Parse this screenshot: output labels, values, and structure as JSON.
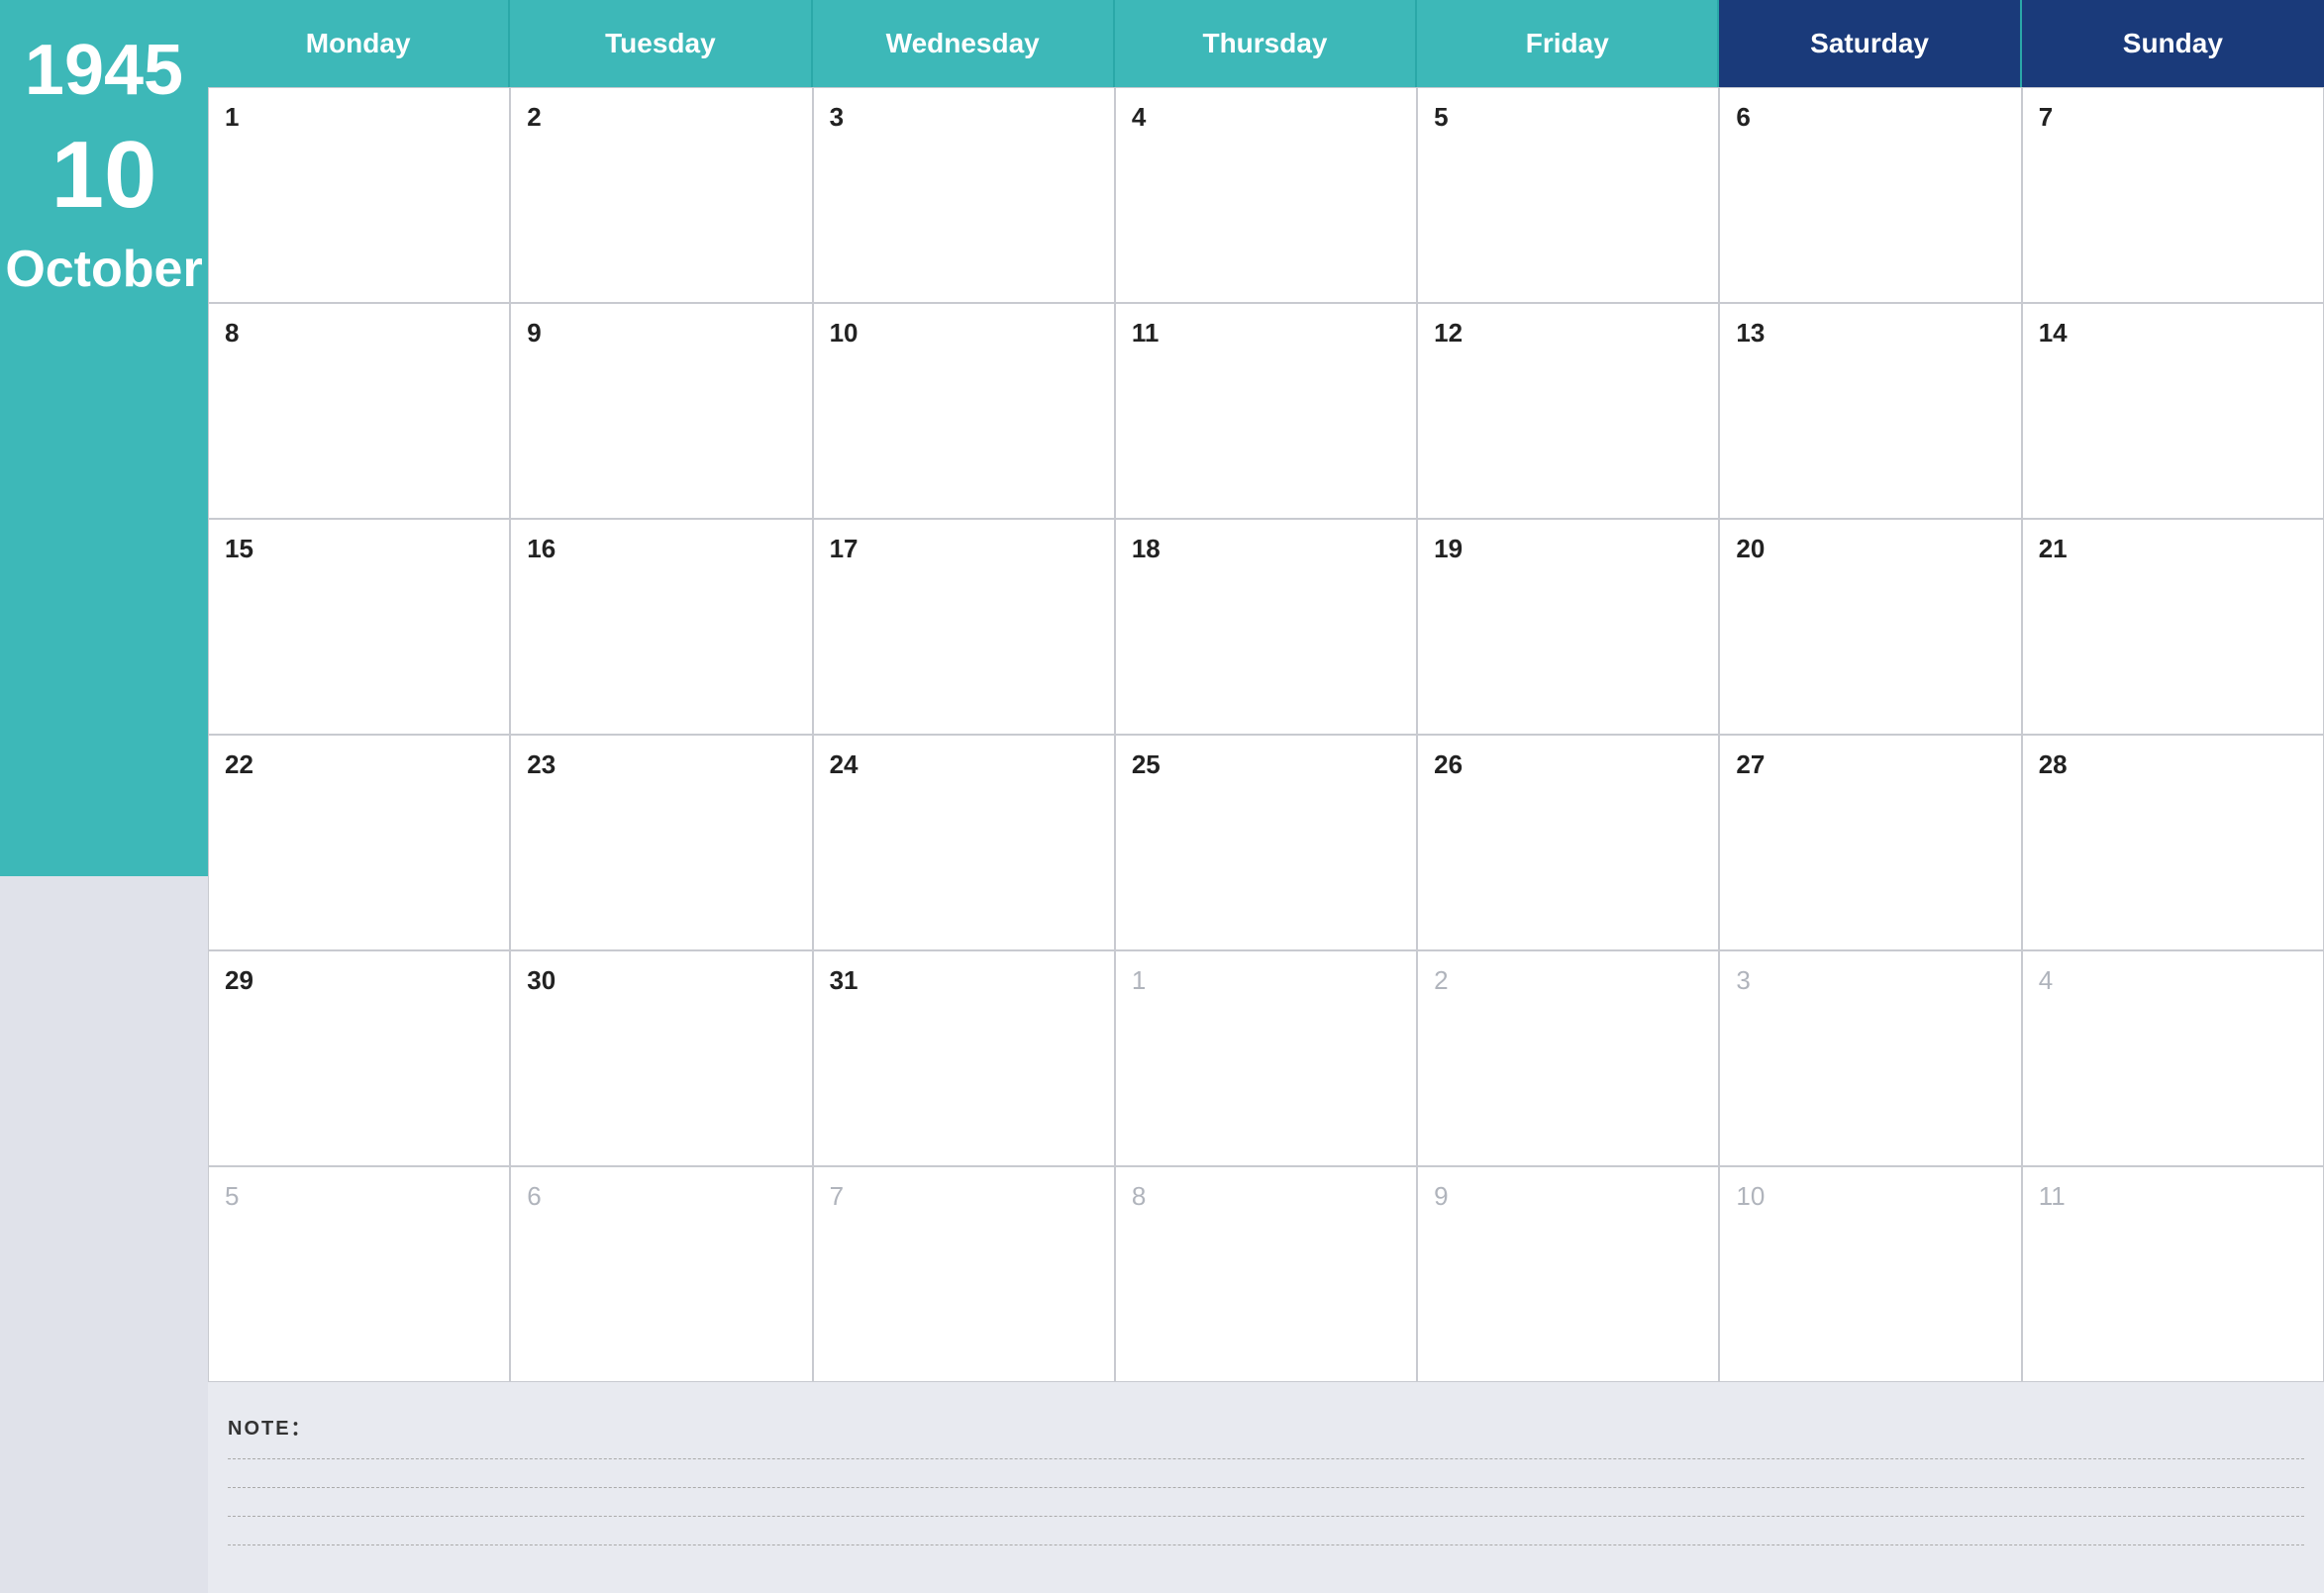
{
  "sidebar": {
    "year": "1945",
    "day": "10",
    "month": "October"
  },
  "header": {
    "days": [
      {
        "label": "Monday",
        "dark": false
      },
      {
        "label": "Tuesday",
        "dark": false
      },
      {
        "label": "Wednesday",
        "dark": false
      },
      {
        "label": "Thursday",
        "dark": false
      },
      {
        "label": "Friday",
        "dark": false
      },
      {
        "label": "Saturday",
        "dark": true
      },
      {
        "label": "Sunday",
        "dark": true
      }
    ]
  },
  "notes": {
    "label": "NOTE："
  },
  "weeks": [
    [
      {
        "num": "1",
        "current": true
      },
      {
        "num": "2",
        "current": true
      },
      {
        "num": "3",
        "current": true
      },
      {
        "num": "4",
        "current": true
      },
      {
        "num": "5",
        "current": true
      },
      {
        "num": "6",
        "current": true
      },
      {
        "num": "7",
        "current": true
      }
    ],
    [
      {
        "num": "8",
        "current": true
      },
      {
        "num": "9",
        "current": true
      },
      {
        "num": "10",
        "current": true
      },
      {
        "num": "11",
        "current": true
      },
      {
        "num": "12",
        "current": true
      },
      {
        "num": "13",
        "current": true
      },
      {
        "num": "14",
        "current": true
      }
    ],
    [
      {
        "num": "15",
        "current": true
      },
      {
        "num": "16",
        "current": true
      },
      {
        "num": "17",
        "current": true
      },
      {
        "num": "18",
        "current": true
      },
      {
        "num": "19",
        "current": true
      },
      {
        "num": "20",
        "current": true
      },
      {
        "num": "21",
        "current": true
      }
    ],
    [
      {
        "num": "22",
        "current": true
      },
      {
        "num": "23",
        "current": true
      },
      {
        "num": "24",
        "current": true
      },
      {
        "num": "25",
        "current": true
      },
      {
        "num": "26",
        "current": true
      },
      {
        "num": "27",
        "current": true
      },
      {
        "num": "28",
        "current": true
      }
    ],
    [
      {
        "num": "29",
        "current": true
      },
      {
        "num": "30",
        "current": true
      },
      {
        "num": "31",
        "current": true
      },
      {
        "num": "1",
        "current": false
      },
      {
        "num": "2",
        "current": false
      },
      {
        "num": "3",
        "current": false
      },
      {
        "num": "4",
        "current": false
      }
    ],
    [
      {
        "num": "5",
        "current": false
      },
      {
        "num": "6",
        "current": false
      },
      {
        "num": "7",
        "current": false
      },
      {
        "num": "8",
        "current": false
      },
      {
        "num": "9",
        "current": false
      },
      {
        "num": "10",
        "current": false
      },
      {
        "num": "11",
        "current": false
      }
    ]
  ]
}
